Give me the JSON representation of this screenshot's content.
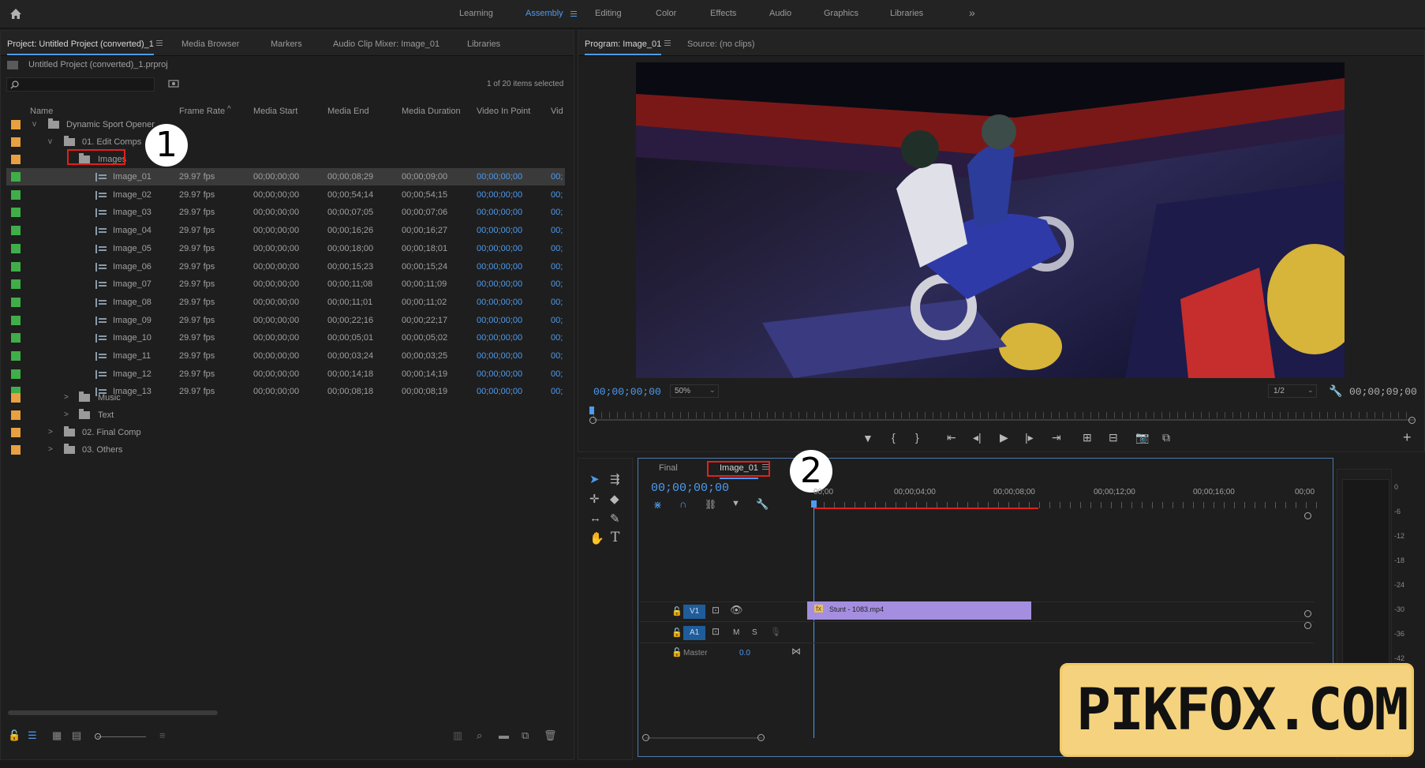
{
  "workspaces": [
    "Learning",
    "Assembly",
    "Editing",
    "Color",
    "Effects",
    "Audio",
    "Graphics",
    "Libraries"
  ],
  "workspace_active": "Assembly",
  "project_panel": {
    "tabs": [
      "Project: Untitled Project (converted)_1",
      "Media Browser",
      "Markers",
      "Audio Clip Mixer: Image_01",
      "Libraries"
    ],
    "project_file": "Untitled Project (converted)_1.prproj",
    "selection_status": "1 of 20 items selected",
    "columns": [
      "Name",
      "Frame Rate",
      "Media Start",
      "Media End",
      "Media Duration",
      "Video In Point",
      "Vid"
    ],
    "folders": {
      "root": "Dynamic Sport Opener",
      "edit_comps": "01. Edit Comps",
      "images": "Images",
      "music": "Music",
      "text": "Text",
      "final_comp": "02. Final Comp",
      "others": "03. Others"
    },
    "sequences": [
      {
        "name": "Image_01",
        "rate": "29.97 fps",
        "start": "00;00;00;00",
        "end": "00;00;08;29",
        "duration": "00;00;09;00",
        "in": "00;00;00;00",
        "vid": "00;"
      },
      {
        "name": "Image_02",
        "rate": "29.97 fps",
        "start": "00;00;00;00",
        "end": "00;00;54;14",
        "duration": "00;00;54;15",
        "in": "00;00;00;00",
        "vid": "00;"
      },
      {
        "name": "Image_03",
        "rate": "29.97 fps",
        "start": "00;00;00;00",
        "end": "00;00;07;05",
        "duration": "00;00;07;06",
        "in": "00;00;00;00",
        "vid": "00;"
      },
      {
        "name": "Image_04",
        "rate": "29.97 fps",
        "start": "00;00;00;00",
        "end": "00;00;16;26",
        "duration": "00;00;16;27",
        "in": "00;00;00;00",
        "vid": "00;"
      },
      {
        "name": "Image_05",
        "rate": "29.97 fps",
        "start": "00;00;00;00",
        "end": "00;00;18;00",
        "duration": "00;00;18;01",
        "in": "00;00;00;00",
        "vid": "00;"
      },
      {
        "name": "Image_06",
        "rate": "29.97 fps",
        "start": "00;00;00;00",
        "end": "00;00;15;23",
        "duration": "00;00;15;24",
        "in": "00;00;00;00",
        "vid": "00;"
      },
      {
        "name": "Image_07",
        "rate": "29.97 fps",
        "start": "00;00;00;00",
        "end": "00;00;11;08",
        "duration": "00;00;11;09",
        "in": "00;00;00;00",
        "vid": "00;"
      },
      {
        "name": "Image_08",
        "rate": "29.97 fps",
        "start": "00;00;00;00",
        "end": "00;00;11;01",
        "duration": "00;00;11;02",
        "in": "00;00;00;00",
        "vid": "00;"
      },
      {
        "name": "Image_09",
        "rate": "29.97 fps",
        "start": "00;00;00;00",
        "end": "00;00;22;16",
        "duration": "00;00;22;17",
        "in": "00;00;00;00",
        "vid": "00;"
      },
      {
        "name": "Image_10",
        "rate": "29.97 fps",
        "start": "00;00;00;00",
        "end": "00;00;05;01",
        "duration": "00;00;05;02",
        "in": "00;00;00;00",
        "vid": "00;"
      },
      {
        "name": "Image_11",
        "rate": "29.97 fps",
        "start": "00;00;00;00",
        "end": "00;00;03;24",
        "duration": "00;00;03;25",
        "in": "00;00;00;00",
        "vid": "00;"
      },
      {
        "name": "Image_12",
        "rate": "29.97 fps",
        "start": "00;00;00;00",
        "end": "00;00;14;18",
        "duration": "00;00;14;19",
        "in": "00;00;00;00",
        "vid": "00;"
      },
      {
        "name": "Image_13",
        "rate": "29.97 fps",
        "start": "00;00;00;00",
        "end": "00;00;08;18",
        "duration": "00;00;08;19",
        "in": "00;00;00;00",
        "vid": "00;"
      }
    ]
  },
  "program_monitor": {
    "tabs": [
      "Program: Image_01",
      "Source: (no clips)"
    ],
    "current_time": "00;00;00;00",
    "zoom": "50%",
    "resolution": "1/2",
    "duration": "00;00;09;00"
  },
  "timeline": {
    "tabs": [
      "Final",
      "Image_01"
    ],
    "current_time": "00;00;00;00",
    "ruler": [
      "00;00",
      "00;00;04;00",
      "00;00;08;00",
      "00;00;12;00",
      "00;00;16;00",
      "00;00"
    ],
    "tracks": {
      "v1": "V1",
      "a1": "A1",
      "mute": "M",
      "solo": "S",
      "master": "Master",
      "master_value": "0.0"
    },
    "clip": {
      "fx": "fx",
      "name": "Stunt - 1083.mp4"
    },
    "meter_labels": [
      "0",
      "-6",
      "-12",
      "-18",
      "-24",
      "-30",
      "-36",
      "-42"
    ]
  },
  "annotations": {
    "badge1": "1",
    "badge2": "2"
  },
  "watermark": "PIKFOX.COM",
  "colors": {
    "accent": "#4d9bf0",
    "label_orange": "#e8a040",
    "label_green": "#3fae48",
    "clip_purple": "#a48ee0",
    "highlight_red": "#e0211b"
  }
}
